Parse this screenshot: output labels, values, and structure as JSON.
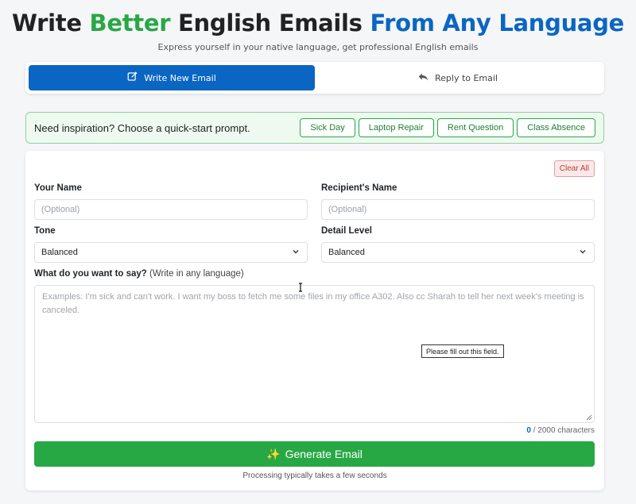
{
  "header": {
    "title_part1": "Write ",
    "title_part2": "Better",
    "title_part3": " English Emails ",
    "title_part4": "From Any Language",
    "subtitle": "Express yourself in your native language, get professional English emails"
  },
  "tabs": [
    {
      "label": "Write New Email",
      "icon": "edit-icon",
      "active": true
    },
    {
      "label": "Reply to Email",
      "icon": "reply-icon",
      "active": false
    }
  ],
  "inspiration": {
    "text": "Need inspiration? Choose a quick-start prompt.",
    "prompts": [
      "Sick Day",
      "Laptop Repair",
      "Rent Question",
      "Class Absence"
    ]
  },
  "form": {
    "clear_label": "Clear All",
    "your_name_label": "Your Name",
    "your_name_placeholder": "(Optional)",
    "recipient_label": "Recipient's Name",
    "recipient_placeholder": "(Optional)",
    "tone_label": "Tone",
    "tone_value": "Balanced",
    "detail_label": "Detail Level",
    "detail_value": "Balanced",
    "message_label": "What do you want to say?",
    "message_hint": "(Write in any language)",
    "message_placeholder": "Examples: I'm sick and can't work. I want my boss to fetch me some files in my office A302. Also cc Sharah to tell her next week's meeting is canceled.",
    "validation_tooltip": "Please fill out this field.",
    "char_count": "0",
    "char_limit_text": " / 2000 characters",
    "generate_label": "Generate Email",
    "processing_note": "Processing typically takes a few seconds"
  },
  "colors": {
    "primary_blue": "#0a66c2",
    "primary_green": "#28a745",
    "danger": "#c0392b"
  }
}
